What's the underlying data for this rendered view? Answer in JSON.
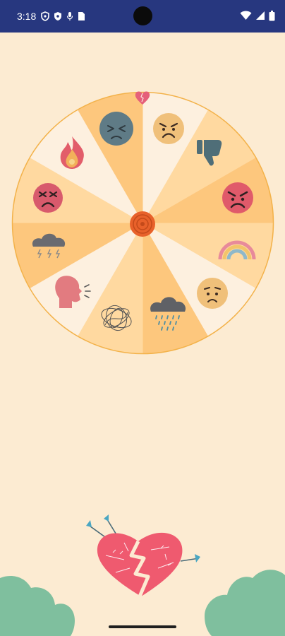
{
  "status_bar": {
    "time": "3:18",
    "background": "#27377f",
    "left_icons": [
      "privacy-shield-icon",
      "vpn-shield-icon",
      "microphone-icon",
      "sim-card-icon"
    ],
    "right_icons": [
      "wifi-icon",
      "cellular-signal-icon",
      "battery-icon"
    ]
  },
  "wheel": {
    "segment_colors": [
      "#fdf0df",
      "#ffd9a0",
      "#fdc77d",
      "#ffd9a0",
      "#fdf0df",
      "#fdc77d",
      "#ffd9a0",
      "#fdf0df",
      "#fdc77d",
      "#ffd9a0",
      "#fdf0df",
      "#fdc77d"
    ],
    "border_color": "#f3b24a",
    "items": [
      "frustrated-face-icon",
      "thumbs-down-icon",
      "angry-face-icon",
      "rainbow-icon",
      "worried-face-icon",
      "rain-cloud-icon",
      "tangled-scribble-icon",
      "shouting-head-icon",
      "thunder-cloud-icon",
      "furious-face-icon",
      "fire-icon",
      "sad-face-icon"
    ],
    "pointer": "heart-pointer-icon",
    "spin_button": "spin-button"
  },
  "decor": {
    "heart": "broken-heart-with-arrows-icon",
    "bushes": "green-bushes"
  },
  "colors": {
    "background": "#fcebd2",
    "heart": "#ef5a6f",
    "bush": "#7fbf9e"
  }
}
